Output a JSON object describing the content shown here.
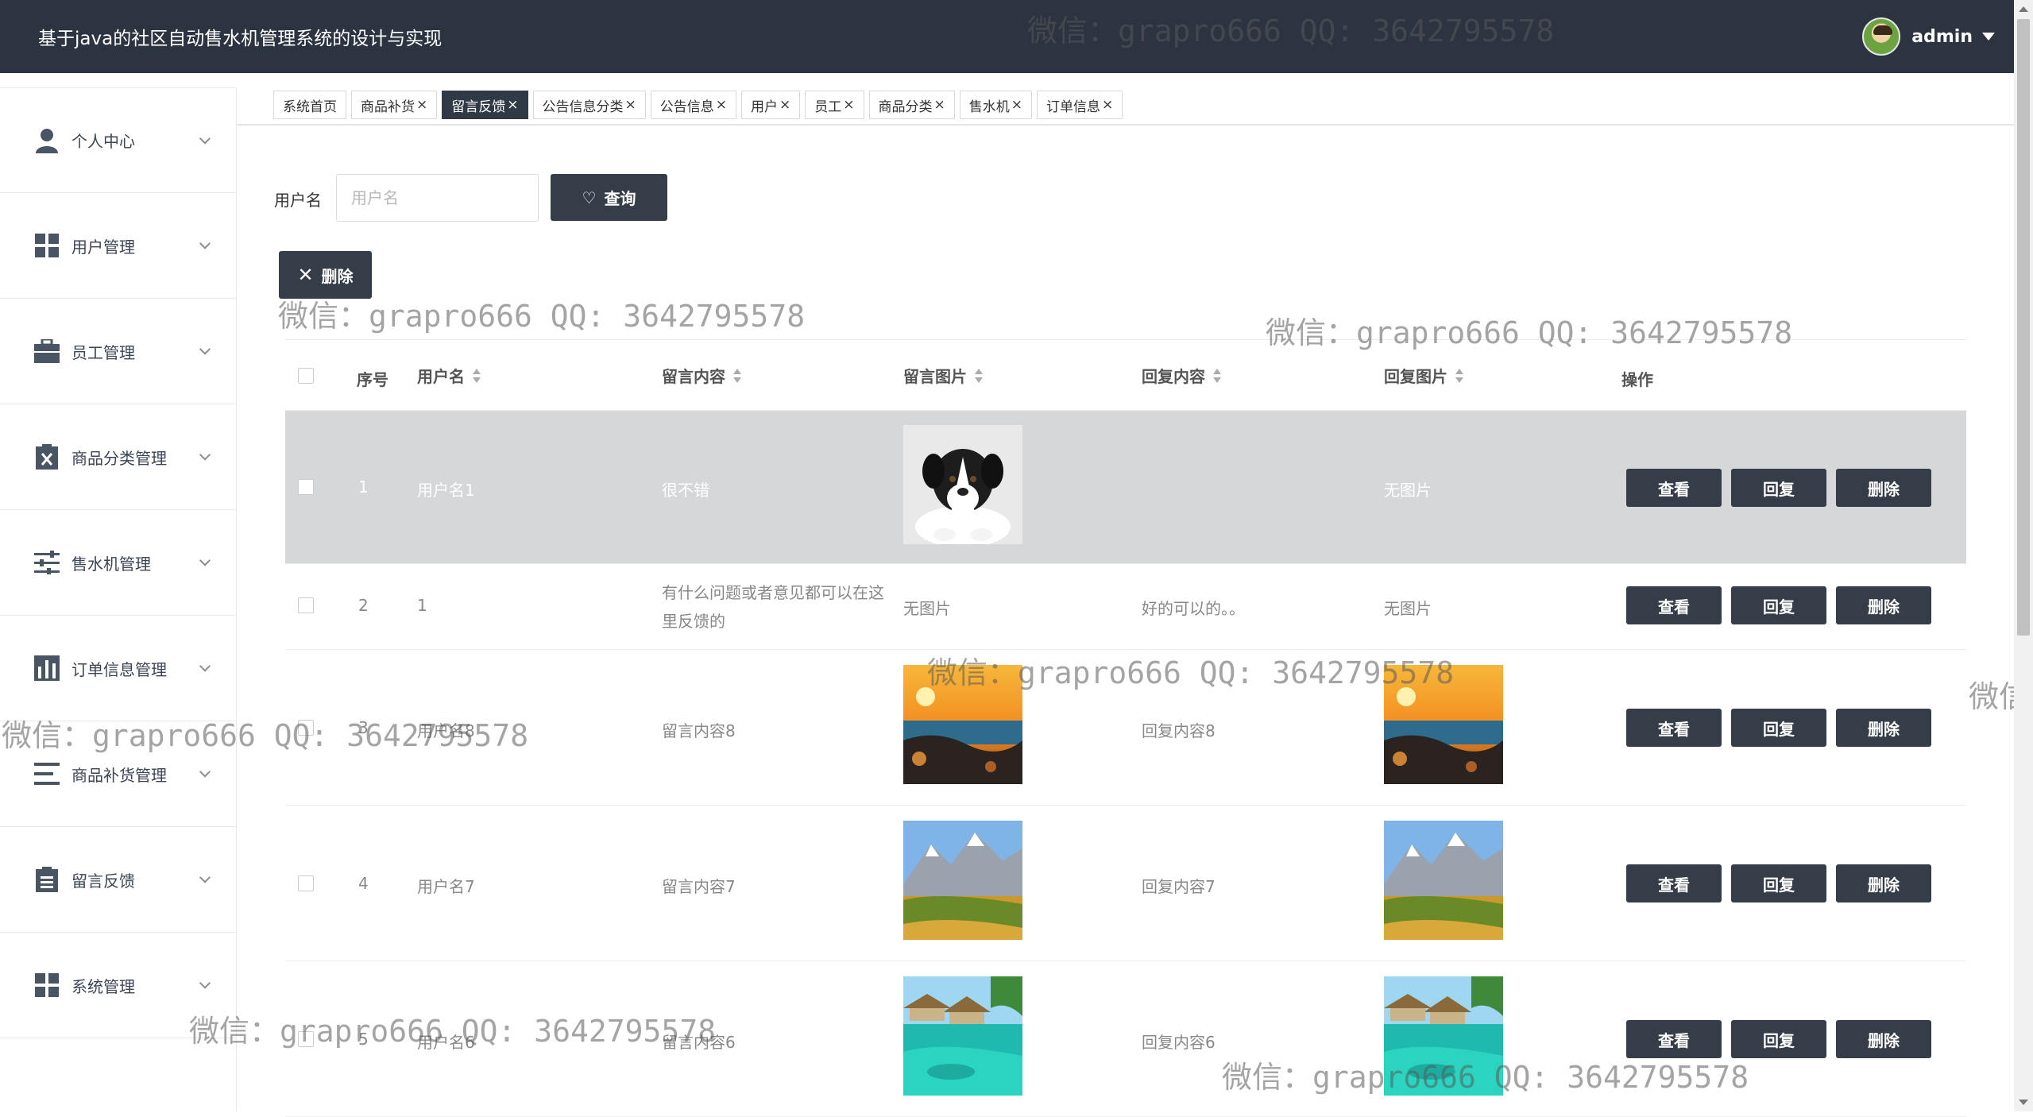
{
  "header": {
    "title": "基于java的社区自动售水机管理系统的设计与实现",
    "user_name": "admin"
  },
  "sidebar": {
    "items": [
      {
        "label": "个人中心",
        "icon": "user-icon"
      },
      {
        "label": "用户管理",
        "icon": "grid-icon"
      },
      {
        "label": "员工管理",
        "icon": "briefcase-icon"
      },
      {
        "label": "商品分类管理",
        "icon": "clipboard-x-icon"
      },
      {
        "label": "售水机管理",
        "icon": "sliders-icon"
      },
      {
        "label": "订单信息管理",
        "icon": "chart-icon"
      },
      {
        "label": "商品补货管理",
        "icon": "list-icon"
      },
      {
        "label": "留言反馈",
        "icon": "clipboard-icon"
      },
      {
        "label": "系统管理",
        "icon": "grid-icon"
      }
    ]
  },
  "tabs": [
    {
      "label": "系统首页",
      "closable": false
    },
    {
      "label": "商品补货",
      "closable": true
    },
    {
      "label": "留言反馈",
      "closable": true,
      "active": true
    },
    {
      "label": "公告信息分类",
      "closable": true
    },
    {
      "label": "公告信息",
      "closable": true
    },
    {
      "label": "用户",
      "closable": true
    },
    {
      "label": "员工",
      "closable": true
    },
    {
      "label": "商品分类",
      "closable": true
    },
    {
      "label": "售水机",
      "closable": true
    },
    {
      "label": "订单信息",
      "closable": true
    }
  ],
  "search": {
    "label": "用户名",
    "placeholder": "用户名",
    "value": "",
    "query_label": "查询"
  },
  "toolbar": {
    "delete_label": "删除"
  },
  "table": {
    "columns": {
      "index": "序号",
      "username": "用户名",
      "content": "留言内容",
      "image": "留言图片",
      "reply": "回复内容",
      "reply_image": "回复图片",
      "ops": "操作"
    },
    "actions": {
      "view": "查看",
      "reply": "回复",
      "delete": "删除"
    },
    "rows": [
      {
        "index": "1",
        "username": "用户名1",
        "content": "很不错",
        "image": "puppy",
        "reply": "",
        "reply_image_text": "无图片",
        "reply_image": "",
        "highlighted": true
      },
      {
        "index": "2",
        "username": "1",
        "content": "有什么问题或者意见都可以在这里反馈的",
        "image_text": "无图片",
        "image": "",
        "reply": "好的可以的。。",
        "reply_image_text": "无图片",
        "reply_image": ""
      },
      {
        "index": "3",
        "username": "用户名8",
        "content": "留言内容8",
        "image": "sunset",
        "reply": "回复内容8",
        "reply_image": "sunset"
      },
      {
        "index": "4",
        "username": "用户名7",
        "content": "留言内容7",
        "image": "mountain",
        "reply": "回复内容7",
        "reply_image": "mountain"
      },
      {
        "index": "5",
        "username": "用户名6",
        "content": "留言内容6",
        "image": "lagoon",
        "reply": "回复内容6",
        "reply_image": "lagoon"
      }
    ]
  },
  "watermark": "微信：grapro666 QQ: 3642795578",
  "watermark_partial": "微信"
}
